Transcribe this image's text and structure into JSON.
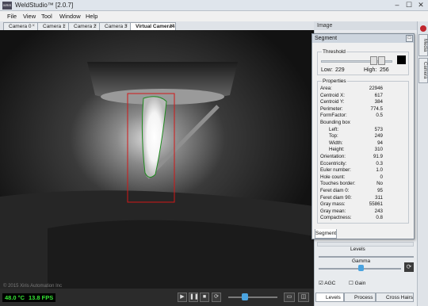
{
  "window": {
    "title": "WeldStudio™ [2.0.7]",
    "icon_label": "XIRIS",
    "min": "–",
    "max": "☐",
    "close": "✕"
  },
  "menu": [
    "File",
    "View",
    "Tool",
    "Window",
    "Help"
  ],
  "camera_tabs": [
    {
      "label": "Camera 0"
    },
    {
      "label": "Camera 1"
    },
    {
      "label": "Camera 2"
    },
    {
      "label": "Camera 3"
    },
    {
      "label": "Virtual Camera4"
    }
  ],
  "tab_close_glyph": "×",
  "video": {
    "copyright": "© 2015 Xiris Automation Inc"
  },
  "status": {
    "temperature": "48.0 °C",
    "fps": "13.8 FPS"
  },
  "controls": {
    "play": "▶",
    "pause": "❚❚",
    "stop": "■",
    "refresh": "⟳"
  },
  "image_panel": {
    "header": "Image"
  },
  "side_tabs": [
    "Media",
    "Camera"
  ],
  "segment": {
    "title": "Segment",
    "threshold": {
      "label": "Threshold",
      "low_label": "Low:",
      "low": "229",
      "high_label": "High:",
      "high": "256"
    },
    "properties_label": "Properties",
    "properties": [
      {
        "k": "Area:",
        "v": "22946"
      },
      {
        "k": "Centroid X:",
        "v": "617"
      },
      {
        "k": "Centroid Y:",
        "v": "384"
      },
      {
        "k": "Perimeter:",
        "v": "774.5"
      },
      {
        "k": "FormFactor:",
        "v": "0.5"
      },
      {
        "k": "Bounding box",
        "v": ""
      },
      {
        "k": "Left:",
        "v": "573",
        "indent": true
      },
      {
        "k": "Top:",
        "v": "249",
        "indent": true
      },
      {
        "k": "Width:",
        "v": "94",
        "indent": true
      },
      {
        "k": "Height:",
        "v": "310",
        "indent": true
      },
      {
        "k": "Orientation:",
        "v": "91.9"
      },
      {
        "k": "Eccentricity:",
        "v": "0.3"
      },
      {
        "k": "Euler number:",
        "v": "1.0"
      },
      {
        "k": "Hole count:",
        "v": "0"
      },
      {
        "k": "Touches border:",
        "v": "No"
      },
      {
        "k": "Feret diam 0:",
        "v": "95"
      },
      {
        "k": "Feret diam 90:",
        "v": "311"
      },
      {
        "k": "Gray mass:",
        "v": "55861"
      },
      {
        "k": "Gray mean:",
        "v": "243"
      },
      {
        "k": "Compactness:",
        "v": "0.8"
      }
    ],
    "tab_label": "Segment"
  },
  "levels_panel": {
    "levels_label": "Levels",
    "gamma_label": "Gamma",
    "agc_label": "AGC",
    "agc_checked": true,
    "gain_label": "Gain",
    "gain_checked": false
  },
  "bottom_tabs": [
    {
      "label": "Levels",
      "active": true
    },
    {
      "label": "Process",
      "active": false
    },
    {
      "label": "Cross Hairs",
      "active": false
    }
  ]
}
